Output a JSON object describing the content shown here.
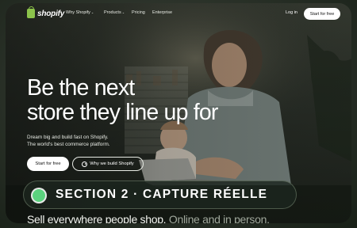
{
  "nav": {
    "logo_text": "shopify",
    "items": [
      {
        "label": "Why Shopify",
        "has_dropdown": true
      },
      {
        "label": "Products",
        "has_dropdown": true
      },
      {
        "label": "Pricing",
        "has_dropdown": false
      },
      {
        "label": "Enterprise",
        "has_dropdown": false
      }
    ],
    "login_label": "Log in",
    "start_label": "Start for free"
  },
  "hero": {
    "headline_line1": "Be the next",
    "headline_line2": "store they line up for",
    "sub_line1": "Dream big and build fast on Shopify.",
    "sub_line2": "The world's best commerce platform.",
    "primary_button": "Start for free",
    "secondary_button": "Why we build Shopify"
  },
  "overlay": {
    "section_label": "SECTION 2 · CAPTURE RÉELLE",
    "indicator_color": "#5bd27e"
  },
  "bottom": {
    "text_primary": "Sell everywhere people shop.",
    "text_secondary": " Online and in person."
  },
  "colors": {
    "brand_green": "#8cc34b",
    "button_bg": "#ffffff"
  }
}
